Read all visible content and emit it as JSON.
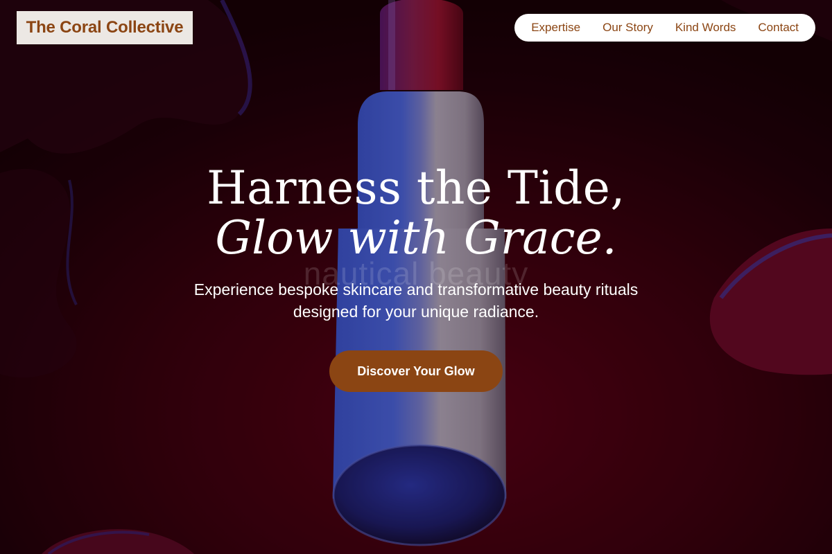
{
  "brand": {
    "name": "The Coral Collective"
  },
  "nav": {
    "items": [
      {
        "label": "Expertise"
      },
      {
        "label": "Our Story"
      },
      {
        "label": "Kind Words"
      },
      {
        "label": "Contact"
      }
    ]
  },
  "hero": {
    "headline_line1": "Harness the Tide,",
    "headline_line2": "Glow with Grace.",
    "ghost_text": "nautical beauty",
    "subtitle": "Experience bespoke skincare and transformative beauty rituals designed for your unique radiance.",
    "cta_label": "Discover Your Glow",
    "background_image": "lipstick-on-crimson-liquid-image"
  },
  "colors": {
    "brand_accent": "#8b4513",
    "brand_bg": "#ece8e4",
    "hero_bg": "#3a000d",
    "text": "#ffffff"
  }
}
